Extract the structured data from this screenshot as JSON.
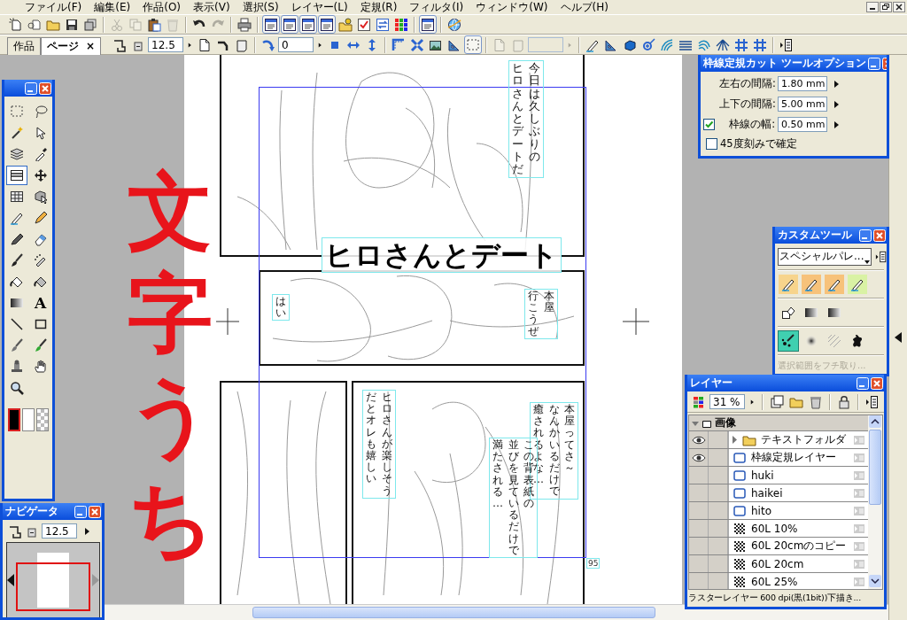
{
  "menu_bar": [
    "ファイル(F)",
    "編集(E)",
    "作品(O)",
    "表示(V)",
    "選択(S)",
    "レイヤー(L)",
    "定規(R)",
    "フィルタ(I)",
    "ウィンドウ(W)",
    "ヘルプ(H)"
  ],
  "toolbar_1": [
    {
      "kind": "new-page",
      "disabled": false,
      "pressed": false
    },
    {
      "kind": "add-page",
      "disabled": false,
      "pressed": false
    },
    {
      "kind": "folder",
      "disabled": false,
      "pressed": false
    },
    {
      "kind": "save",
      "disabled": false,
      "pressed": false
    },
    {
      "kind": "stack",
      "disabled": false,
      "pressed": false
    },
    {
      "kind": "separator"
    },
    {
      "kind": "scissors",
      "disabled": true,
      "pressed": false
    },
    {
      "kind": "copy",
      "disabled": true,
      "pressed": false
    },
    {
      "kind": "clipboard",
      "disabled": false,
      "pressed": false
    },
    {
      "kind": "trash",
      "disabled": true,
      "pressed": false
    },
    {
      "kind": "separator"
    },
    {
      "kind": "undo",
      "disabled": false,
      "pressed": false
    },
    {
      "kind": "redo",
      "disabled": true,
      "pressed": false
    },
    {
      "kind": "separator"
    },
    {
      "kind": "printer",
      "disabled": false,
      "pressed": false
    },
    {
      "kind": "separator"
    },
    {
      "kind": "layout",
      "disabled": false,
      "pressed": true
    },
    {
      "kind": "layout",
      "disabled": false,
      "pressed": true
    },
    {
      "kind": "layout",
      "disabled": false,
      "pressed": true
    },
    {
      "kind": "layout",
      "disabled": false,
      "pressed": true
    },
    {
      "kind": "key-folder",
      "disabled": false,
      "pressed": false
    },
    {
      "kind": "checkbox",
      "disabled": false,
      "pressed": false
    },
    {
      "kind": "swap",
      "disabled": false,
      "pressed": false
    },
    {
      "kind": "color-grid",
      "disabled": false,
      "pressed": false
    },
    {
      "kind": "separator"
    },
    {
      "kind": "layout",
      "disabled": false,
      "pressed": true
    },
    {
      "kind": "separator"
    },
    {
      "kind": "globe",
      "disabled": false,
      "pressed": false
    }
  ],
  "toolbar_2": {
    "tabs": [
      {
        "label": "作品",
        "selected": false
      },
      {
        "label": "ページ",
        "selected": true,
        "close": "×"
      }
    ],
    "items": [
      {
        "kind": "zoom-fit",
        "disabled": false,
        "pressed": false
      },
      {
        "kind": "minus-box",
        "disabled": false,
        "pressed": false
      },
      {
        "kind": "field",
        "value": "12.5",
        "disabled": false
      },
      {
        "kind": "arrow-right",
        "disabled": false,
        "pressed": false
      },
      {
        "kind": "page",
        "disabled": false,
        "pressed": false
      },
      {
        "kind": "bend-arrow",
        "disabled": false,
        "pressed": false
      },
      {
        "kind": "page-flip",
        "disabled": false,
        "pressed": false
      },
      {
        "kind": "separator"
      },
      {
        "kind": "rotate",
        "disabled": false,
        "pressed": false
      },
      {
        "kind": "field",
        "value": "0",
        "disabled": false
      },
      {
        "kind": "arrow-right",
        "disabled": false,
        "pressed": false
      },
      {
        "kind": "dot",
        "disabled": false,
        "pressed": false
      },
      {
        "kind": "h-arrows",
        "disabled": false,
        "pressed": false
      },
      {
        "kind": "v-arrows",
        "disabled": false,
        "pressed": false
      },
      {
        "kind": "separator"
      },
      {
        "kind": "ruler",
        "disabled": false,
        "pressed": false
      },
      {
        "kind": "cross-arrows",
        "disabled": false,
        "pressed": false
      },
      {
        "kind": "image",
        "disabled": false,
        "pressed": false
      },
      {
        "kind": "set-square",
        "disabled": false,
        "pressed": false
      },
      {
        "kind": "marquee",
        "disabled": false,
        "pressed": true
      },
      {
        "kind": "separator"
      },
      {
        "kind": "page",
        "disabled": true,
        "pressed": false
      },
      {
        "kind": "page-flip",
        "disabled": true,
        "pressed": false
      },
      {
        "kind": "field",
        "disabled": true
      },
      {
        "kind": "arrow-right",
        "disabled": true,
        "pressed": false
      },
      {
        "kind": "separator"
      },
      {
        "kind": "pen",
        "disabled": false,
        "pressed": false
      },
      {
        "kind": "set-square",
        "disabled": false,
        "pressed": false
      },
      {
        "kind": "cube",
        "disabled": false,
        "pressed": false
      },
      {
        "kind": "sparkle",
        "disabled": false,
        "pressed": false
      },
      {
        "kind": "curve",
        "disabled": false,
        "pressed": false
      },
      {
        "kind": "lines",
        "disabled": false,
        "pressed": false
      },
      {
        "kind": "concentric",
        "disabled": false,
        "pressed": false
      },
      {
        "kind": "sun",
        "disabled": false,
        "pressed": false
      },
      {
        "kind": "hash",
        "disabled": false,
        "pressed": false
      },
      {
        "kind": "hash",
        "disabled": false,
        "pressed": false
      },
      {
        "kind": "separator"
      },
      {
        "kind": "panel-menu",
        "disabled": false,
        "pressed": false
      }
    ]
  },
  "tool_palette": {
    "tools": [
      {
        "kind": "marquee",
        "selected": false
      },
      {
        "kind": "lasso",
        "selected": false
      },
      {
        "kind": "wand",
        "selected": false
      },
      {
        "kind": "pointer",
        "selected": false
      },
      {
        "kind": "layers",
        "selected": false
      },
      {
        "kind": "eyedropper",
        "selected": false
      },
      {
        "kind": "ruler-cut",
        "selected": true
      },
      {
        "kind": "move",
        "selected": false
      },
      {
        "kind": "grid",
        "selected": false
      },
      {
        "kind": "object-select",
        "selected": false
      },
      {
        "kind": "pen",
        "selected": false
      },
      {
        "kind": "pencil",
        "selected": false
      },
      {
        "kind": "marker",
        "selected": false
      },
      {
        "kind": "eraser",
        "selected": false
      },
      {
        "kind": "brush",
        "selected": false
      },
      {
        "kind": "airbrush",
        "selected": false
      },
      {
        "kind": "bucket",
        "selected": false
      },
      {
        "kind": "pattern-bucket",
        "selected": false
      },
      {
        "kind": "gradient",
        "selected": false
      },
      {
        "kind": "text",
        "label": "A",
        "selected": false
      },
      {
        "kind": "line",
        "selected": false
      },
      {
        "kind": "rect",
        "selected": false
      },
      {
        "kind": "dropper-brush",
        "selected": false
      },
      {
        "kind": "green-brush",
        "selected": false
      },
      {
        "kind": "stamp",
        "selected": false
      },
      {
        "kind": "hand",
        "selected": false
      },
      {
        "kind": "zoom",
        "selected": false
      }
    ],
    "colors": [
      {
        "kind": "solid",
        "color": "#000000",
        "selected": true
      },
      {
        "kind": "solid",
        "color": "#ffffff",
        "selected": false
      },
      {
        "kind": "transparent",
        "selected": false
      }
    ]
  },
  "navigator": {
    "title": "ナビゲータ",
    "zoom": "12.5"
  },
  "tool_options": {
    "title": "枠線定規カット ツールオプション",
    "rows": [
      {
        "kind": "spin",
        "label": "左右の間隔:",
        "value": "1.80 mm"
      },
      {
        "kind": "spin",
        "label": "上下の間隔:",
        "value": "5.00 mm"
      },
      {
        "kind": "check_spin",
        "label": "枠線の幅:",
        "value": "0.50 mm",
        "checked": true
      },
      {
        "kind": "check",
        "label": "45度刻みで確定",
        "checked": false
      }
    ]
  },
  "custom_tools": {
    "title": "カスタムツール",
    "set": "スペシャルパレ...",
    "rows": [
      [
        {
          "kind": "pen",
          "color": "#f7d48c",
          "selected": false
        },
        {
          "kind": "pen",
          "color": "#f7c27a",
          "selected": false
        },
        {
          "kind": "pen",
          "color": "#f7c27a",
          "selected": false
        },
        {
          "kind": "pen",
          "color": "#d9f2a4",
          "selected": false
        }
      ],
      [
        {
          "kind": "fill-shape",
          "selected": false
        },
        {
          "kind": "gradient",
          "selected": false
        },
        {
          "kind": "gradient",
          "selected": false
        }
      ],
      [
        {
          "kind": "scatter-brush",
          "selected": true
        },
        {
          "kind": "blur",
          "selected": false
        },
        {
          "kind": "hatch",
          "selected": false
        },
        {
          "kind": "blob",
          "selected": false
        }
      ]
    ],
    "command": {
      "label": "選択範囲をフチ取り...",
      "disabled": true
    }
  },
  "layer_palette": {
    "title": "レイヤー",
    "toolbar": [
      {
        "kind": "color-swatches"
      },
      {
        "kind": "field",
        "value": "31 %"
      },
      {
        "kind": "arrow-right"
      },
      {
        "kind": "separator"
      },
      {
        "kind": "new-layer"
      },
      {
        "kind": "folder"
      },
      {
        "kind": "trash"
      },
      {
        "kind": "separator"
      },
      {
        "kind": "lock"
      },
      {
        "kind": "separator"
      },
      {
        "kind": "panel-menu"
      }
    ],
    "group": {
      "name": "画像",
      "expanded": true
    },
    "layers": [
      {
        "name": "テキストフォルダ",
        "kind": "folder",
        "visible": true,
        "expanded": false
      },
      {
        "name": "枠線定規レイヤー",
        "kind": "vector",
        "visible": true
      },
      {
        "name": "huki",
        "kind": "vector",
        "visible": false
      },
      {
        "name": "haikei",
        "kind": "vector",
        "visible": false
      },
      {
        "name": "hito",
        "kind": "vector",
        "visible": false
      },
      {
        "name": "60L 10%",
        "kind": "tone",
        "visible": false
      },
      {
        "name": "60L 20cmのコピー",
        "kind": "tone",
        "visible": false
      },
      {
        "name": "60L 20cm",
        "kind": "tone",
        "visible": false
      },
      {
        "name": "60L 25%",
        "kind": "tone",
        "visible": false
      }
    ],
    "status": "ラスターレイヤー 600 dpi(黒(1bit))下描き..."
  },
  "page": {
    "title_text": "ヒロさんとデート",
    "balloons": [
      {
        "lines": [
          "ヒロさんとデートだ",
          "今日は久しぶりの"
        ]
      },
      {
        "lines": [
          "はい"
        ]
      },
      {
        "lines": [
          "行こうぜ",
          "本屋"
        ]
      },
      {
        "lines": [
          "だとオレも嬉しい",
          "ヒロさんが楽しそう"
        ]
      },
      {
        "lines": [
          "癒されるよな…",
          "なんかいるだけで",
          "本屋ってさ～"
        ]
      },
      {
        "lines": [
          "満たされる…",
          "並びを見ているだけで",
          "この背表紙の"
        ]
      }
    ],
    "page_number": "95"
  },
  "annotation": "文字うち"
}
